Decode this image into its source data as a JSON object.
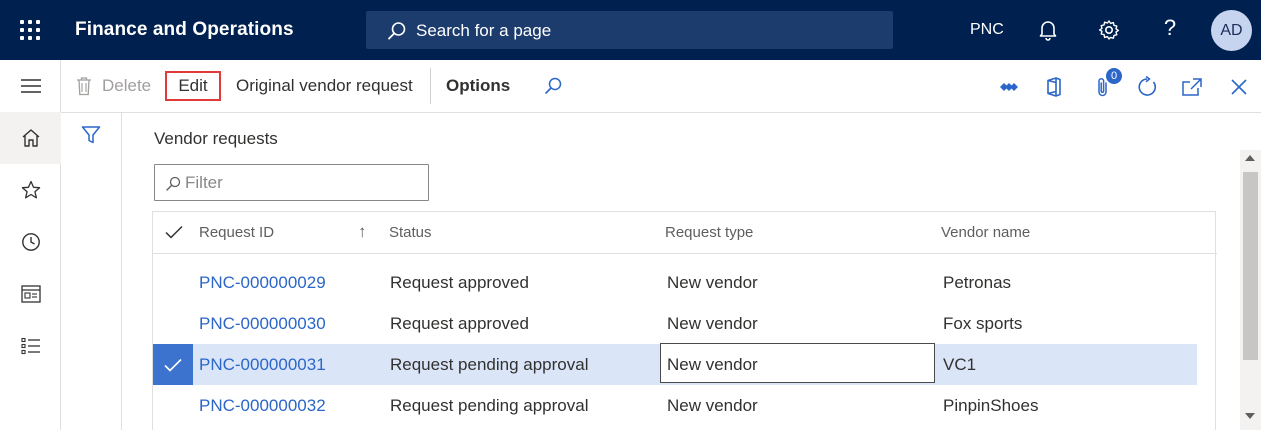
{
  "app": {
    "title": "Finance and Operations",
    "search_label": "Search for a page",
    "company": "PNC",
    "user_initials": "AD",
    "topbar_color": "#002050"
  },
  "nav_rail": {
    "items": [
      {
        "name": "hamburger-icon"
      },
      {
        "name": "home-icon"
      },
      {
        "name": "star-icon"
      },
      {
        "name": "clock-icon"
      },
      {
        "name": "workspace-icon"
      },
      {
        "name": "list-icon"
      }
    ]
  },
  "action_pane": {
    "delete_label": "Delete",
    "edit_label": "Edit",
    "original_label": "Original vendor request",
    "options_label": "Options",
    "attachments_count": "0"
  },
  "page": {
    "section_title": "Vendor requests",
    "filter_placeholder": "Filter"
  },
  "grid": {
    "columns": {
      "request_id": "Request ID",
      "status": "Status",
      "request_type": "Request type",
      "vendor_name": "Vendor name"
    },
    "sort_indicator": "↑",
    "rows": [
      {
        "id": "PNC-000000029",
        "status": "Request approved",
        "type": "New vendor",
        "vendor": "Petronas",
        "selected": false
      },
      {
        "id": "PNC-000000030",
        "status": "Request approved",
        "type": "New vendor",
        "vendor": "Fox sports",
        "selected": false
      },
      {
        "id": "PNC-000000031",
        "status": "Request pending approval",
        "type": "New vendor",
        "vendor": "VC1",
        "selected": true
      },
      {
        "id": "PNC-000000032",
        "status": "Request pending approval",
        "type": "New vendor",
        "vendor": "PinpinShoes",
        "selected": false
      }
    ]
  },
  "colors": {
    "link": "#2b66c8",
    "selected_row": "#dae6f8",
    "selected_check": "#3b73cf",
    "edit_highlight": "#e03a3a"
  }
}
